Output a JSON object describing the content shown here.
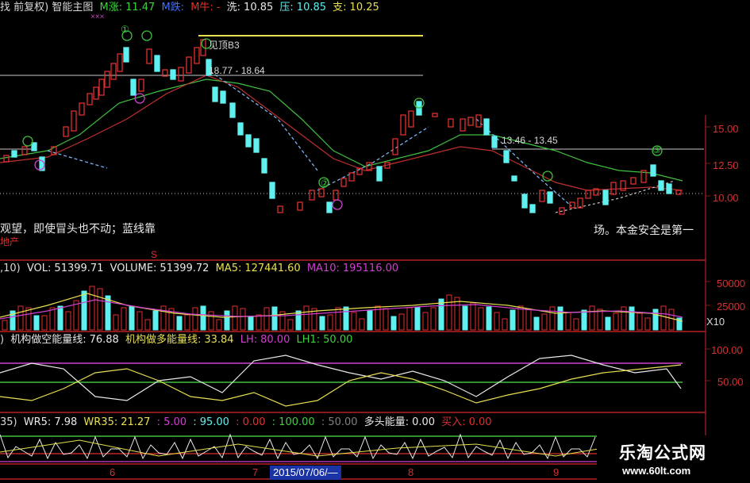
{
  "colors": {
    "up": "#e03030",
    "down": "#5ff0f0",
    "ma_green": "#40c040",
    "ma_red": "#c03030",
    "yellow": "#e8e050",
    "magenta": "#d040d0",
    "white": "#e8e8e8",
    "grid": "#8a1a1a",
    "green_text": "#40d040",
    "blue_text": "#4070ff",
    "red_text": "#e03030"
  },
  "main_header": {
    "title": "找 前复权) 智能主图",
    "m_zhang_label": "M涨:",
    "m_zhang_value": "11.47",
    "m_die_label": "M跌:",
    "m_niu_label": "M牛:",
    "m_niu_value": "-",
    "xi_label": "洗:",
    "xi_value": "10.85",
    "ya_label": "压:",
    "ya_value": "10.85",
    "zhi_label": "支:",
    "zhi_value": "10.25",
    "marks": "×××"
  },
  "main_panel": {
    "y_ticks": [
      "15.00",
      "12.50",
      "10.00"
    ],
    "price_level_1": "18.77 - 18.64",
    "price_level_2": "13.46 - 13.45",
    "peak_label": "见顶B3",
    "note_left": "观望，即使冒头也不动；蓝线靠",
    "note_right": "场。本金安全是第一",
    "left_tag": "地产",
    "small_tag": "S",
    "signal_label_1": "①",
    "signal_label_2": "②",
    "signal_label_3": "③"
  },
  "volume_header": {
    "prefix": ",10)",
    "vol_label": "VOL:",
    "vol_value": "51399.71",
    "volume_label": "VOLUME:",
    "volume_value": "51399.72",
    "ma5_label": "MA5:",
    "ma5_value": "127441.60",
    "ma10_label": "MA10:",
    "ma10_value": "195116.00"
  },
  "volume_panel": {
    "y_ticks": [
      "50000",
      "25000"
    ],
    "unit": "X10"
  },
  "energy_header": {
    "prefix": ")",
    "short_label": "机构做空能量线:",
    "short_value": "76.88",
    "long_label": "机构做多能量线:",
    "long_value": "33.84",
    "lh_label": "LH:",
    "lh_value": "80.00",
    "lh1_label": "LH1:",
    "lh1_value": "50.00"
  },
  "energy_panel": {
    "y_ticks": [
      "100.00",
      "50.00"
    ]
  },
  "wr_header": {
    "prefix": "35)",
    "wr5_label": "WR5:",
    "wr5_value": "7.98",
    "wr35_label": "WR35:",
    "wr35_value": "21.27",
    "v1": ": 5.00",
    "v2": ": 95.00",
    "v3": ": 0.00",
    "v4": ": 100.00",
    "v5": ": 50.00",
    "dt_label": "多头能量:",
    "dt_value": "0.00",
    "buy_label": "买入:",
    "buy_value": "0.00"
  },
  "x_axis": {
    "labels": [
      "6",
      "7",
      "8",
      "9"
    ],
    "cursor_date": "2015/07/06/—"
  },
  "watermark": {
    "name": "乐淘公式网",
    "url": "www.60lt.com"
  }
}
